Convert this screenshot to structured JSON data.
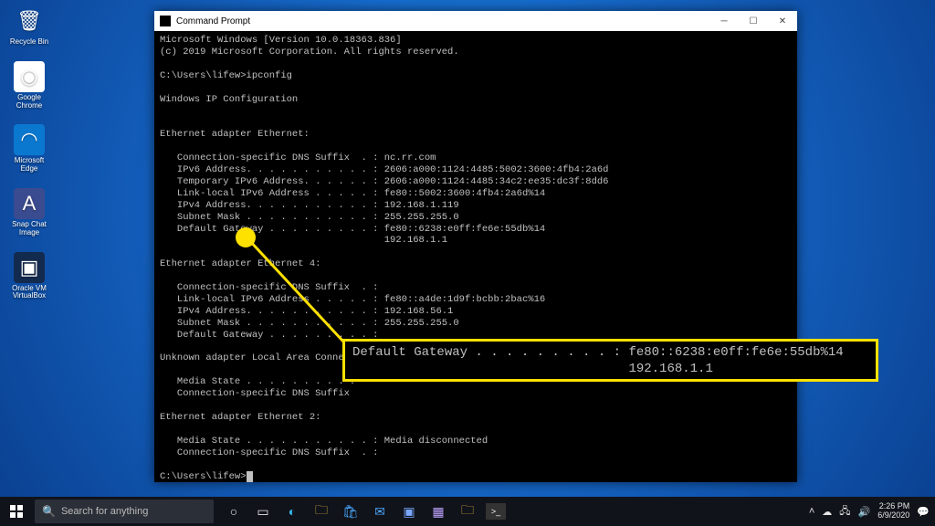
{
  "desktop_icons": [
    {
      "name": "recycle-bin",
      "label": "Recycle Bin",
      "glyph": "🗑"
    },
    {
      "name": "google-chrome",
      "label": "Google Chrome",
      "glyph": "◉"
    },
    {
      "name": "microsoft-edge",
      "label": "Microsoft Edge",
      "glyph": "◠"
    },
    {
      "name": "snap-chat-image",
      "label": "Snap Chat Image",
      "glyph": "A"
    },
    {
      "name": "oracle-vm-virtualbox",
      "label": "Oracle VM VirtualBox",
      "glyph": "▣"
    }
  ],
  "cmd": {
    "title": "Command Prompt",
    "header1": "Microsoft Windows [Version 10.0.18363.836]",
    "header2": "(c) 2019 Microsoft Corporation. All rights reserved.",
    "prompt1": "C:\\Users\\lifew>ipconfig",
    "wip": "Windows IP Configuration",
    "sectA": "Ethernet adapter Ethernet:",
    "a1": "   Connection-specific DNS Suffix  . : nc.rr.com",
    "a2": "   IPv6 Address. . . . . . . . . . . : 2606:a000:1124:4485:5002:3600:4fb4:2a6d",
    "a3": "   Temporary IPv6 Address. . . . . . : 2606:a000:1124:4485:34c2:ee35:dc3f:8dd6",
    "a4": "   Link-local IPv6 Address . . . . . : fe80::5002:3600:4fb4:2a6d%14",
    "a5": "   IPv4 Address. . . . . . . . . . . : 192.168.1.119",
    "a6": "   Subnet Mask . . . . . . . . . . . : 255.255.255.0",
    "a7": "   Default Gateway . . . . . . . . . : fe80::6238:e0ff:fe6e:55db%14",
    "a8": "                                       192.168.1.1",
    "sectB": "Ethernet adapter Ethernet 4:",
    "b1": "   Connection-specific DNS Suffix  . :",
    "b2": "   Link-local IPv6 Address . . . . . : fe80::a4de:1d9f:bcbb:2bac%16",
    "b3": "   IPv4 Address. . . . . . . . . . . : 192.168.56.1",
    "b4": "   Subnet Mask . . . . . . . . . . . : 255.255.255.0",
    "b5": "   Default Gateway . . . . . . . . . :",
    "sectC": "Unknown adapter Local Area Connect",
    "c1": "   Media State . . . . . . . . . .",
    "c2": "   Connection-specific DNS Suffix",
    "sectD": "Ethernet adapter Ethernet 2:",
    "d1": "   Media State . . . . . . . . . . . : Media disconnected",
    "d2": "   Connection-specific DNS Suffix  . :",
    "prompt2": "C:\\Users\\lifew>"
  },
  "callout": {
    "line1": "Default Gateway . . . . . . . . . : fe80::6238:e0ff:fe6e:55db%14",
    "line2": "                                    192.168.1.1"
  },
  "taskbar": {
    "search_placeholder": "Search for anything",
    "time": "2:26 PM",
    "date": "6/9/2020"
  }
}
